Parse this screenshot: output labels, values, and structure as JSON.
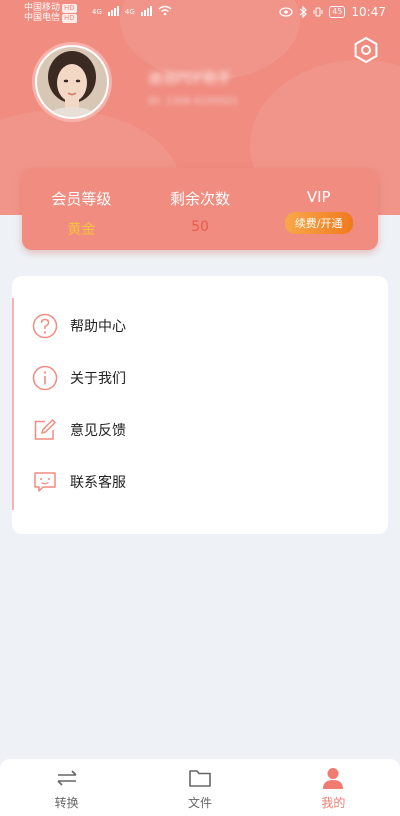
{
  "status_bar": {
    "carrier1": "中国移动",
    "carrier2": "中国电信",
    "hd_badge": "HD",
    "signal1": "4G",
    "signal2": "4G",
    "battery": "45",
    "time": "10:47"
  },
  "profile": {
    "name": "迪泡PDF助手",
    "subtitle": "ID: 1326 0155521"
  },
  "stats": {
    "level_label": "会员等级",
    "level_value": "黄金",
    "remaining_label": "剩余次数",
    "remaining_value": "50",
    "vip_label": "VIP",
    "vip_button": "续费/开通"
  },
  "menu": {
    "items": [
      {
        "label": "帮助中心",
        "icon": "help-icon"
      },
      {
        "label": "关于我们",
        "icon": "info-icon"
      },
      {
        "label": "意见反馈",
        "icon": "feedback-icon"
      },
      {
        "label": "联系客服",
        "icon": "service-chat-icon"
      }
    ]
  },
  "nav": {
    "items": [
      {
        "label": "转换",
        "icon": "convert-icon"
      },
      {
        "label": "文件",
        "icon": "folder-icon"
      },
      {
        "label": "我的",
        "icon": "user-icon"
      }
    ],
    "active": "我的"
  },
  "colors": {
    "brand": "#f08c80",
    "gold": "#f6c23e",
    "remaining": "#e95c4c",
    "vip_button": "#f59134"
  }
}
